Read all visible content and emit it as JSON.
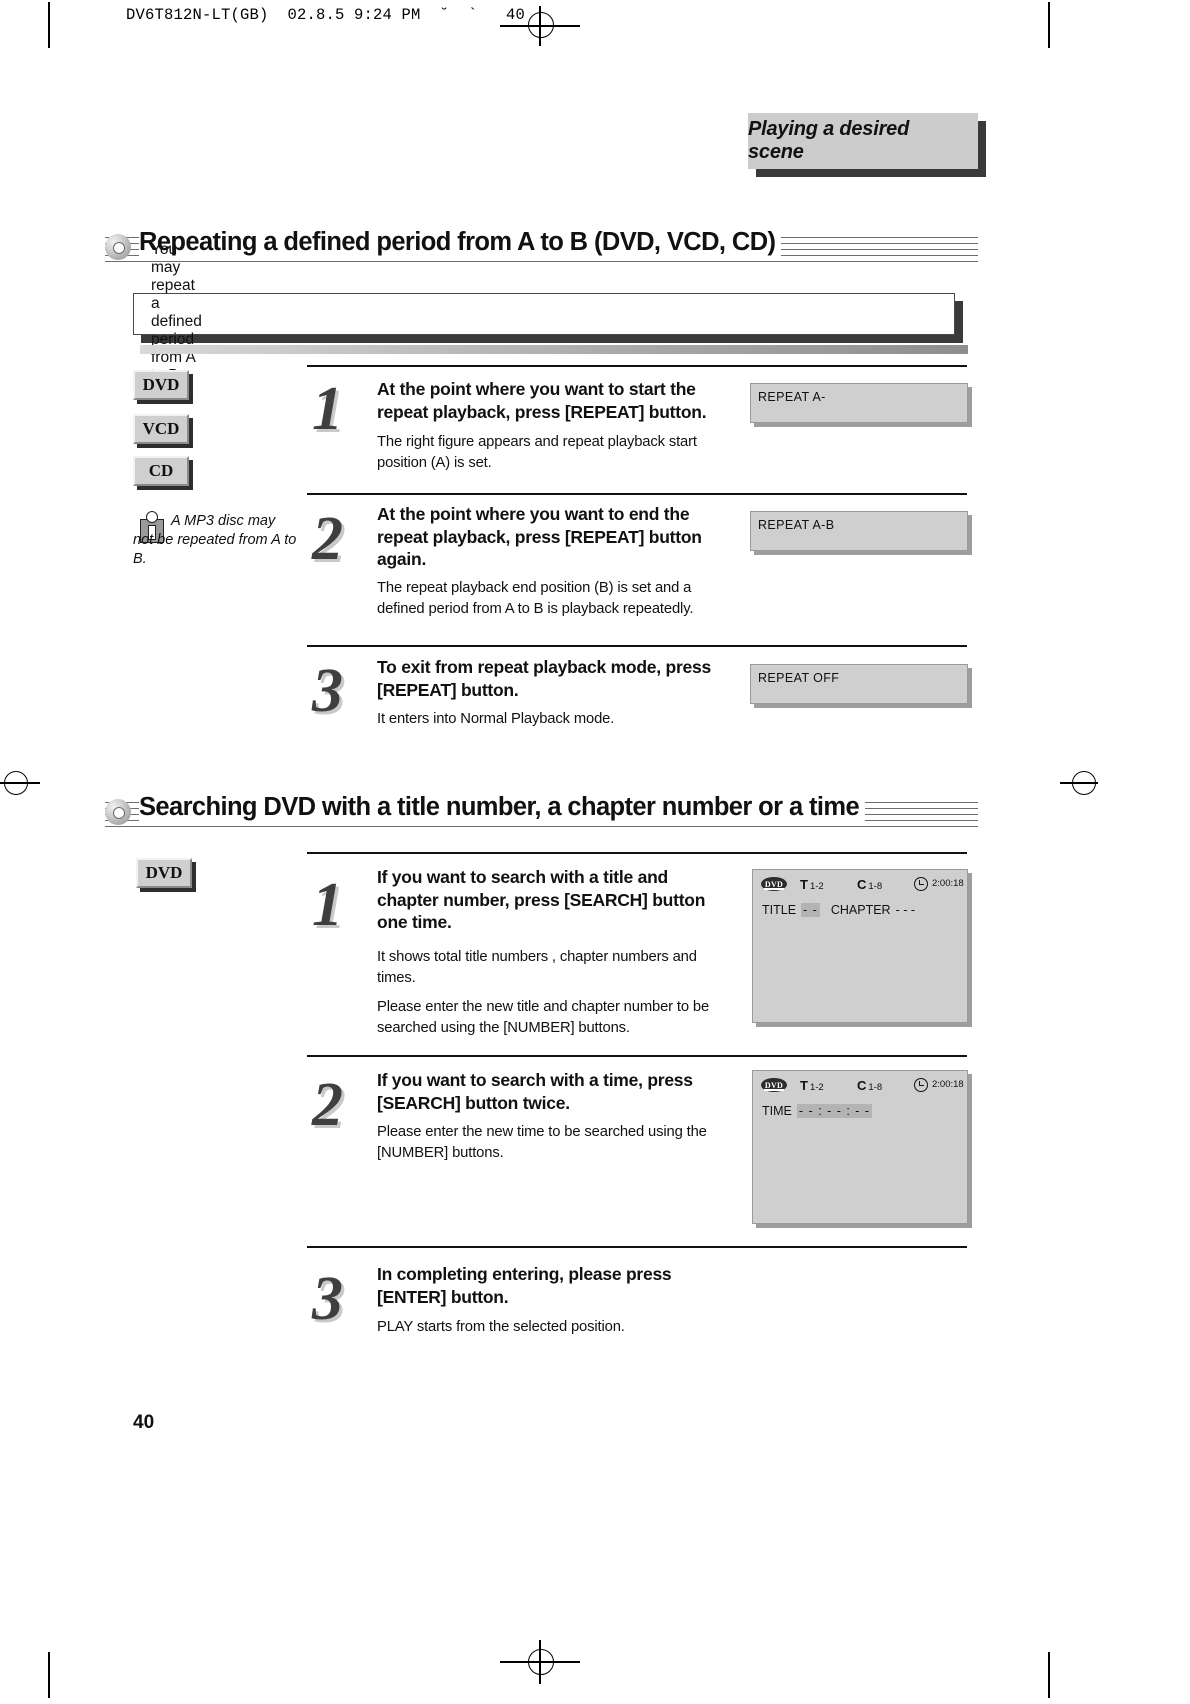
{
  "slug": "DV6T812N-LT(GB)  02.8.5 9:24 PM  ˘  `   40",
  "header": {
    "tab_title": "Playing a desired scene"
  },
  "page_number": "40",
  "sections": [
    {
      "id": "repeat-ab",
      "title": "Repeating a defined period from A to B (DVD, VCD, CD)",
      "note": "You may repeat a defined period from A to B.",
      "badges": [
        "DVD",
        "VCD",
        "CD"
      ],
      "tip": "A MP3 disc may not be repeated from A to B.",
      "steps": [
        {
          "number": "1",
          "title": "At the point where you want to start the repeat playback, press [REPEAT] button.",
          "body": [
            "The right figure appears and repeat playback start position (A) is set."
          ],
          "osd": {
            "type": "text",
            "label": "REPEAT A-"
          }
        },
        {
          "number": "2",
          "title": "At the point where you want to end the repeat playback, press [REPEAT] button again.",
          "body": [
            "The repeat playback end position (B) is set and a defined period from A to B is playback repeatedly."
          ],
          "osd": {
            "type": "text",
            "label": "REPEAT A-B"
          }
        },
        {
          "number": "3",
          "title": "To exit from repeat playback mode, press [REPEAT] button.",
          "body": [
            "It enters into Normal Playback mode."
          ],
          "osd": {
            "type": "text",
            "label": "REPEAT OFF"
          }
        }
      ]
    },
    {
      "id": "search-dvd",
      "title": "Searching DVD with a title number, a chapter number or a time",
      "badges": [
        "DVD"
      ],
      "steps": [
        {
          "number": "1",
          "title": "If you want to search with a title and chapter number, press [SEARCH] button one time.",
          "body": [
            "It shows total title numbers , chapter numbers and times.",
            "Please enter the new title and chapter number to be searched using the [NUMBER] buttons."
          ],
          "osd": {
            "type": "panel",
            "logo": "DVD",
            "title_field": {
              "letter": "T",
              "value": "1-2"
            },
            "chapter_field": {
              "letter": "C",
              "value": "1-8"
            },
            "time_value": "2:00:18",
            "rows": [
              {
                "label": "TITLE",
                "value": "- -",
                "label2": "CHAPTER",
                "value2": "- - -"
              }
            ]
          }
        },
        {
          "number": "2",
          "title": "If you want to search with a time, press [SEARCH] button twice.",
          "body": [
            "Please enter the new time to be searched using the [NUMBER] buttons."
          ],
          "osd": {
            "type": "panel",
            "logo": "DVD",
            "title_field": {
              "letter": "T",
              "value": "1-2"
            },
            "chapter_field": {
              "letter": "C",
              "value": "1-8"
            },
            "time_value": "2:00:18",
            "rows": [
              {
                "label": "TIME",
                "value": "- - : - - : - -"
              }
            ]
          }
        },
        {
          "number": "3",
          "title": "In completing entering, please press [ENTER] button.",
          "body": [
            "PLAY starts from the selected position."
          ],
          "osd": null
        }
      ]
    }
  ]
}
